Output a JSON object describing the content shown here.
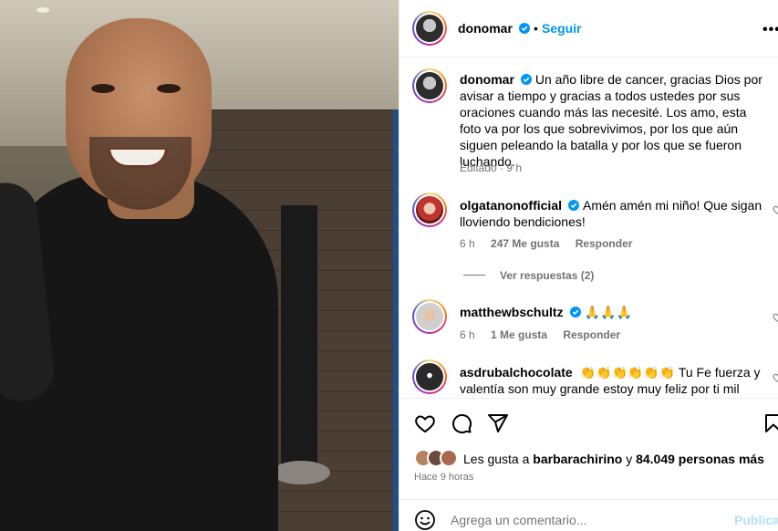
{
  "header": {
    "username": "donomar",
    "separator": "•",
    "follow_label": "Seguir",
    "more_label": "•••"
  },
  "caption": {
    "username": "donomar",
    "text": "Un año libre de cancer, gracias Dios por avisar a tiempo y gracias a todos ustedes por sus oraciones cuando más las necesité. Los amo, esta foto va por los que sobrevivimos, por los que aún siguen peleando la batalla y por los que se fueron luchando.",
    "edited": "Editado",
    "dot": "·",
    "time": "9 h"
  },
  "comments": [
    {
      "username": "olgatanonofficial",
      "text": "Amén amén mi niño! Que sigan lloviendo bendiciones!",
      "time": "6 h",
      "likes": "247 Me gusta",
      "reply": "Responder",
      "view_replies": "Ver respuestas (2)"
    },
    {
      "username": "matthewbschultz",
      "text": "🙏🙏🙏",
      "time": "6 h",
      "likes": "1 Me gusta",
      "reply": "Responder"
    },
    {
      "username": "asdrubalchocolate",
      "text": "👏👏👏👏👏👏 Tu Fe fuerza y valentía son muy grande estoy muy feliz por ti mil"
    }
  ],
  "likes_line": {
    "prefix": "Les gusta a",
    "user": "barbarachirino",
    "connector": "y",
    "others": "84.049 personas más"
  },
  "posted": "Hace 9 horas",
  "add_comment": {
    "placeholder": "Agrega un comentario...",
    "post_label": "Publicar"
  },
  "colors": {
    "link_blue": "#0095f6",
    "muted": "#737373",
    "post_disabled": "#b2dffc",
    "verified": "#0095f6"
  },
  "icons": [
    "heart-icon",
    "comment-icon",
    "share-icon",
    "bookmark-icon",
    "smiley-icon",
    "verified-badge-icon",
    "more-options-icon"
  ]
}
